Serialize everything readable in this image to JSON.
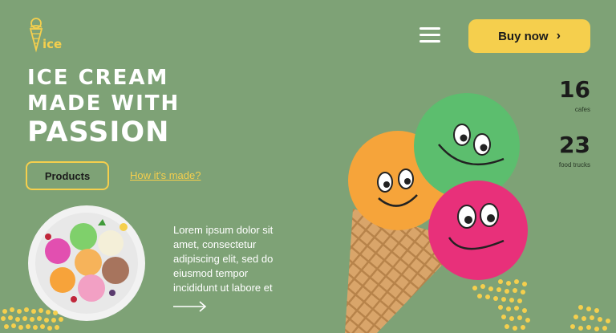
{
  "brand": {
    "logo_text": "ice",
    "logo_icon": "ice-cream-cone-icon"
  },
  "header": {
    "menu_icon": "hamburger-menu-icon",
    "buy_label": "Buy now",
    "buy_icon": "chevron-right-icon"
  },
  "hero": {
    "title_line1": "ICE CREAM",
    "title_line2": "MADE WITH",
    "title_line3": "PASSION",
    "products_label": "Products",
    "how_label": "How it's made?",
    "description": "Lorem ipsum dolor sit amet, consectetur adipiscing elit, sed do eiusmod tempor incididunt ut labore et",
    "arrow_icon": "arrow-right-icon"
  },
  "stats": [
    {
      "value": "16",
      "label": "cafes"
    },
    {
      "value": "23",
      "label": "food trucks"
    }
  ],
  "colors": {
    "background": "#7ea276",
    "accent": "#f5cf4d",
    "dark": "#1b1b1b",
    "green_scoop": "#5cbe6e",
    "orange_scoop": "#f6a43a",
    "pink_scoop": "#e8307a"
  }
}
